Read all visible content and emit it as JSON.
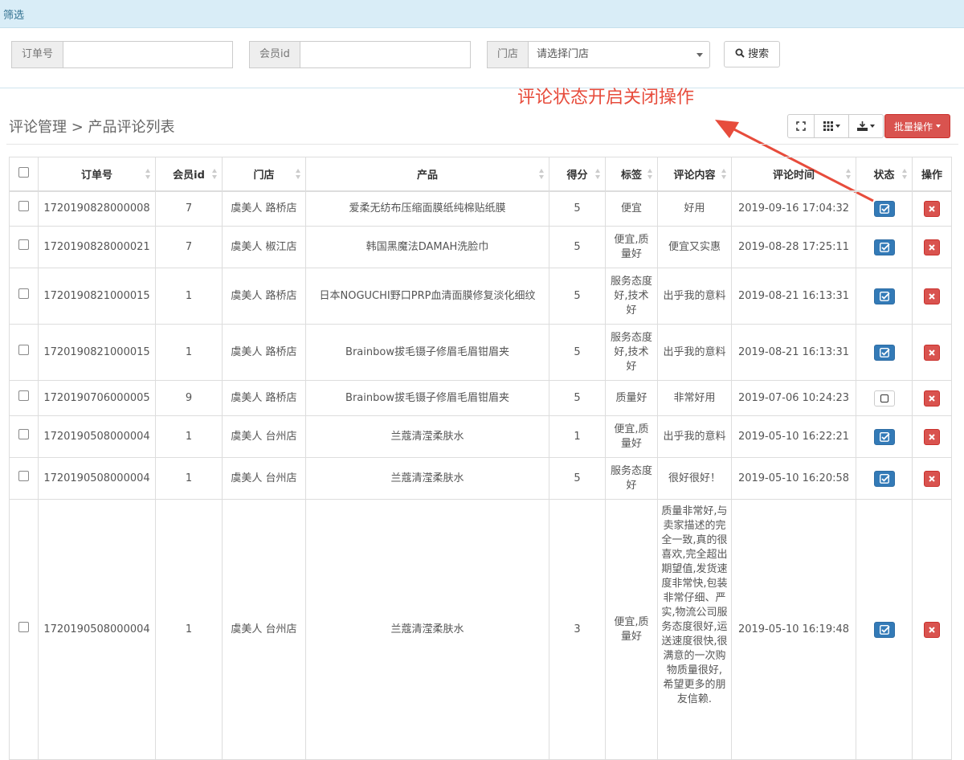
{
  "filter": {
    "title": "筛选",
    "order_label": "订单号",
    "order_value": "",
    "member_label": "会员id",
    "member_value": "",
    "store_label": "门店",
    "store_placeholder": "请选择门店",
    "search_label": "搜索"
  },
  "annotation": "评论状态开启关闭操作",
  "breadcrumb": "评论管理 > 产品评论列表",
  "toolbar": {
    "batch_label": "批量操作"
  },
  "table": {
    "headers": [
      "订单号",
      "会员id",
      "门店",
      "产品",
      "得分",
      "标签",
      "评论内容",
      "评论时间",
      "状态",
      "操作"
    ],
    "rows": [
      {
        "order": "1720190828000008",
        "member": "7",
        "store": "虞美人 路桥店",
        "product": "爱柔无纺布压缩面膜纸纯棉贴纸膜",
        "score": "5",
        "tags": "便宜",
        "content": "好用",
        "time": "2019-09-16 17:04:32",
        "status": true
      },
      {
        "order": "1720190828000021",
        "member": "7",
        "store": "虞美人 椒江店",
        "product": "韩国黑魔法DAMAH洗脸巾",
        "score": "5",
        "tags": "便宜,质量好",
        "content": "便宜又实惠",
        "time": "2019-08-28 17:25:11",
        "status": true
      },
      {
        "order": "1720190821000015",
        "member": "1",
        "store": "虞美人 路桥店",
        "product": "日本NOGUCHI野口PRP血清面膜修复淡化细纹",
        "score": "5",
        "tags": "服务态度好,技术好",
        "content": "出乎我的意料",
        "time": "2019-08-21 16:13:31",
        "status": true
      },
      {
        "order": "1720190821000015",
        "member": "1",
        "store": "虞美人 路桥店",
        "product": "Brainbow拔毛镊子修眉毛眉钳眉夹",
        "score": "5",
        "tags": "服务态度好,技术好",
        "content": "出乎我的意料",
        "time": "2019-08-21 16:13:31",
        "status": true
      },
      {
        "order": "1720190706000005",
        "member": "9",
        "store": "虞美人 路桥店",
        "product": "Brainbow拔毛镊子修眉毛眉钳眉夹",
        "score": "5",
        "tags": "质量好",
        "content": "非常好用",
        "time": "2019-07-06 10:24:23",
        "status": false
      },
      {
        "order": "1720190508000004",
        "member": "1",
        "store": "虞美人 台州店",
        "product": "兰蔻清滢柔肤水",
        "score": "1",
        "tags": "便宜,质量好",
        "content": "出乎我的意料",
        "time": "2019-05-10 16:22:21",
        "status": true
      },
      {
        "order": "1720190508000004",
        "member": "1",
        "store": "虞美人 台州店",
        "product": "兰蔻清滢柔肤水",
        "score": "5",
        "tags": "服务态度好",
        "content": "很好很好！",
        "time": "2019-05-10 16:20:58",
        "status": true
      },
      {
        "order": "1720190508000004",
        "member": "1",
        "store": "虞美人 台州店",
        "product": "兰蔻清滢柔肤水",
        "score": "3",
        "tags": "便宜,质量好",
        "content": "质量非常好,与卖家描述的完全一致,真的很喜欢,完全超出期望值,发货速度非常快,包装非常仔细、严实,物流公司服务态度很好,运送速度很快,很满意的一次购物质量很好, 希望更多的朋友信赖.",
        "time": "2019-05-10 16:19:48",
        "status": true
      }
    ]
  },
  "colors": {
    "accent": "#337ab7",
    "danger": "#d9534f",
    "annotation": "#e74c3c",
    "filter_bg": "#d9edf7"
  }
}
